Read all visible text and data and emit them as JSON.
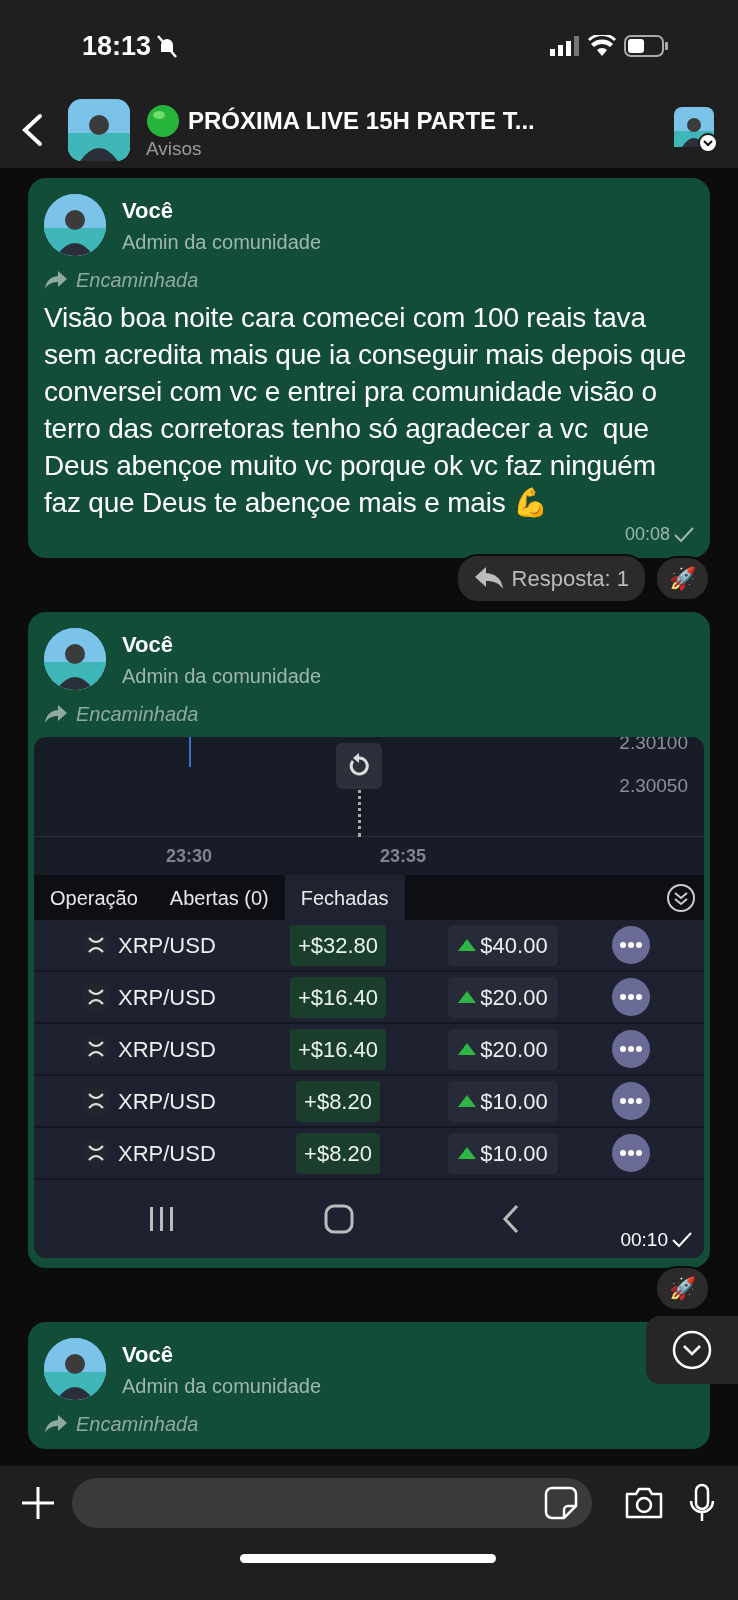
{
  "status_bar": {
    "time": "18:13"
  },
  "header": {
    "title": "PRÓXIMA LIVE 15H PARTE T...",
    "subtitle": "Avisos"
  },
  "messages": [
    {
      "kind": "text",
      "sender": "Você",
      "role": "Admin da comunidade",
      "forwarded": "Encaminhada",
      "text": "Visão boa noite cara comecei com 100 reais tava sem acredita mais que ia conseguir mais depois que conversei com vc e entrei pra comunidade visão o terro das corretoras tenho só agradecer a vc  que Deus abençoe muito vc porque ok vc faz ninguém faz que Deus te abençoe mais e mais 💪",
      "time": "00:08",
      "replies": "Resposta: 1",
      "reaction": "🚀"
    },
    {
      "kind": "screenshot",
      "sender": "Você",
      "role": "Admin da comunidade",
      "forwarded": "Encaminhada",
      "time": "00:10",
      "reaction": "🚀",
      "screenshot": {
        "y_labels": [
          "2.30100",
          "2.30050"
        ],
        "x_labels": [
          "23:30",
          "23:35"
        ],
        "tabs": [
          {
            "label": "Operação",
            "selected": false
          },
          {
            "label": "Abertas (0)",
            "selected": false
          },
          {
            "label": "Fechadas",
            "selected": true
          }
        ],
        "trades": [
          {
            "pair": "XRP/USD",
            "profit": "+$32.80",
            "amount": "$40.00"
          },
          {
            "pair": "XRP/USD",
            "profit": "+$16.40",
            "amount": "$20.00"
          },
          {
            "pair": "XRP/USD",
            "profit": "+$16.40",
            "amount": "$20.00"
          },
          {
            "pair": "XRP/USD",
            "profit": "+$8.20",
            "amount": "$10.00"
          },
          {
            "pair": "XRP/USD",
            "profit": "+$8.20",
            "amount": "$10.00"
          }
        ]
      }
    },
    {
      "kind": "text",
      "sender": "Você",
      "role": "Admin da comunidade",
      "forwarded": "Encaminhada"
    }
  ]
}
